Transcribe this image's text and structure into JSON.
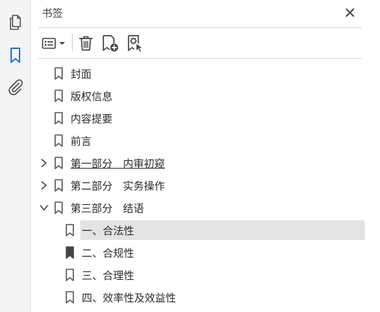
{
  "panel": {
    "title": "书签"
  },
  "rail": {
    "items": [
      {
        "name": "page-thumbnails-icon"
      },
      {
        "name": "bookmarks-icon",
        "active": true
      },
      {
        "name": "attachments-icon"
      }
    ]
  },
  "toolbar": {
    "icons": [
      "options-menu-icon",
      "delete-bookmark-icon",
      "new-bookmark-icon",
      "new-bookmark-from-structure-icon"
    ]
  },
  "bookmarks": [
    {
      "label": "封面",
      "level": 0,
      "expander": "none"
    },
    {
      "label": "版权信息",
      "level": 0,
      "expander": "none"
    },
    {
      "label": "内容提要",
      "level": 0,
      "expander": "none"
    },
    {
      "label": "前言",
      "level": 0,
      "expander": "none"
    },
    {
      "label": "第一部分　内审初窥",
      "level": 0,
      "expander": "collapsed",
      "underline": true
    },
    {
      "label": "第二部分　实务操作",
      "level": 0,
      "expander": "collapsed"
    },
    {
      "label": "第三部分　结语",
      "level": 0,
      "expander": "expanded"
    },
    {
      "label": "一、合法性",
      "level": 1,
      "selected": true
    },
    {
      "label": "二、合规性",
      "level": 1
    },
    {
      "label": "三、合理性",
      "level": 1
    },
    {
      "label": "四、效率性及效益性",
      "level": 1
    }
  ],
  "colors": {
    "accent": "#1473e6",
    "selected_row": "#e3e3e3",
    "icon": "#555555"
  }
}
